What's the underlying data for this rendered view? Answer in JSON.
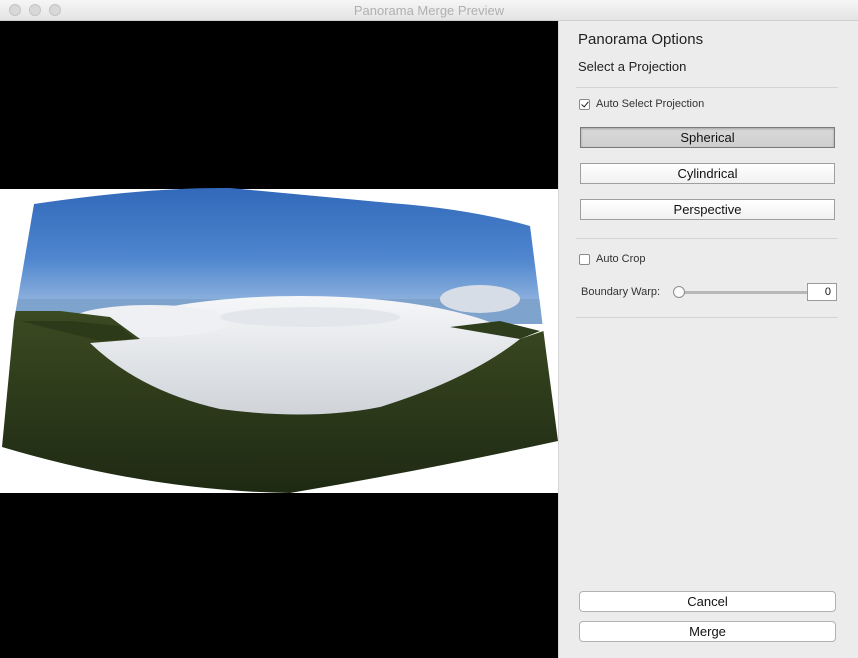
{
  "window": {
    "title": "Panorama Merge Preview"
  },
  "panel": {
    "title": "Panorama Options",
    "subtitle": "Select a Projection",
    "auto_select_projection": {
      "label": "Auto Select Projection",
      "checked": true
    },
    "projections": [
      {
        "label": "Spherical",
        "selected": true
      },
      {
        "label": "Cylindrical",
        "selected": false
      },
      {
        "label": "Perspective",
        "selected": false
      }
    ],
    "auto_crop": {
      "label": "Auto Crop",
      "checked": false
    },
    "boundary_warp": {
      "label": "Boundary Warp:",
      "value": "0",
      "level": 0
    }
  },
  "footer": {
    "cancel_label": "Cancel",
    "merge_label": "Merge"
  },
  "colors": {
    "preview_background": "#000000",
    "panel_background": "#ececec"
  }
}
